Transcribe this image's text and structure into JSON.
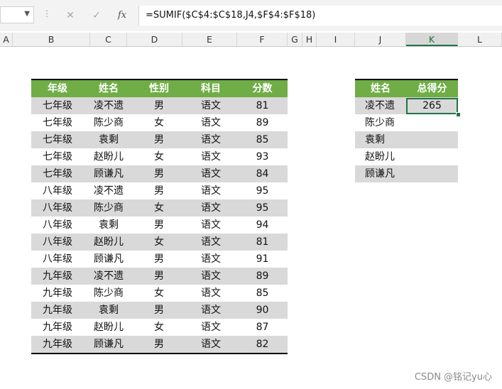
{
  "formula_bar": {
    "name_box": "",
    "cancel_icon": "✕",
    "confirm_icon": "✓",
    "fx_label": "fx",
    "formula": "=SUMIF($C$4:$C$18,J4,$F$4:$F$18)"
  },
  "columns": [
    "A",
    "B",
    "C",
    "D",
    "E",
    "F",
    "G",
    "H",
    "I",
    "J",
    "K",
    "L"
  ],
  "main_table": {
    "headers": [
      "年级",
      "姓名",
      "性别",
      "科目",
      "分数"
    ],
    "rows": [
      [
        "七年级",
        "凌不遗",
        "男",
        "语文",
        "81"
      ],
      [
        "七年级",
        "陈少商",
        "女",
        "语文",
        "89"
      ],
      [
        "七年级",
        "袁剩",
        "男",
        "语文",
        "85"
      ],
      [
        "七年级",
        "赵盼儿",
        "女",
        "语文",
        "93"
      ],
      [
        "七年级",
        "顾谦凡",
        "男",
        "语文",
        "84"
      ],
      [
        "八年级",
        "凌不遗",
        "男",
        "语文",
        "95"
      ],
      [
        "八年级",
        "陈少商",
        "女",
        "语文",
        "95"
      ],
      [
        "八年级",
        "袁剩",
        "男",
        "语文",
        "94"
      ],
      [
        "八年级",
        "赵盼儿",
        "女",
        "语文",
        "81"
      ],
      [
        "八年级",
        "顾谦凡",
        "男",
        "语文",
        "91"
      ],
      [
        "九年级",
        "凌不遗",
        "男",
        "语文",
        "89"
      ],
      [
        "九年级",
        "陈少商",
        "女",
        "语文",
        "85"
      ],
      [
        "九年级",
        "袁剩",
        "男",
        "语文",
        "90"
      ],
      [
        "九年级",
        "赵盼儿",
        "女",
        "语文",
        "87"
      ],
      [
        "九年级",
        "顾谦凡",
        "男",
        "语文",
        "82"
      ]
    ]
  },
  "summary_table": {
    "headers": [
      "姓名",
      "总得分"
    ],
    "rows": [
      [
        "凌不遗",
        "265"
      ],
      [
        "陈少商",
        ""
      ],
      [
        "袁剩",
        ""
      ],
      [
        "赵盼儿",
        ""
      ],
      [
        "顾谦凡",
        ""
      ]
    ]
  },
  "watermark": "CSDN @铭记yu心",
  "colors": {
    "header_green": "#70ad47",
    "stripe_gray": "#d9d9d9",
    "select_green": "#217346"
  }
}
